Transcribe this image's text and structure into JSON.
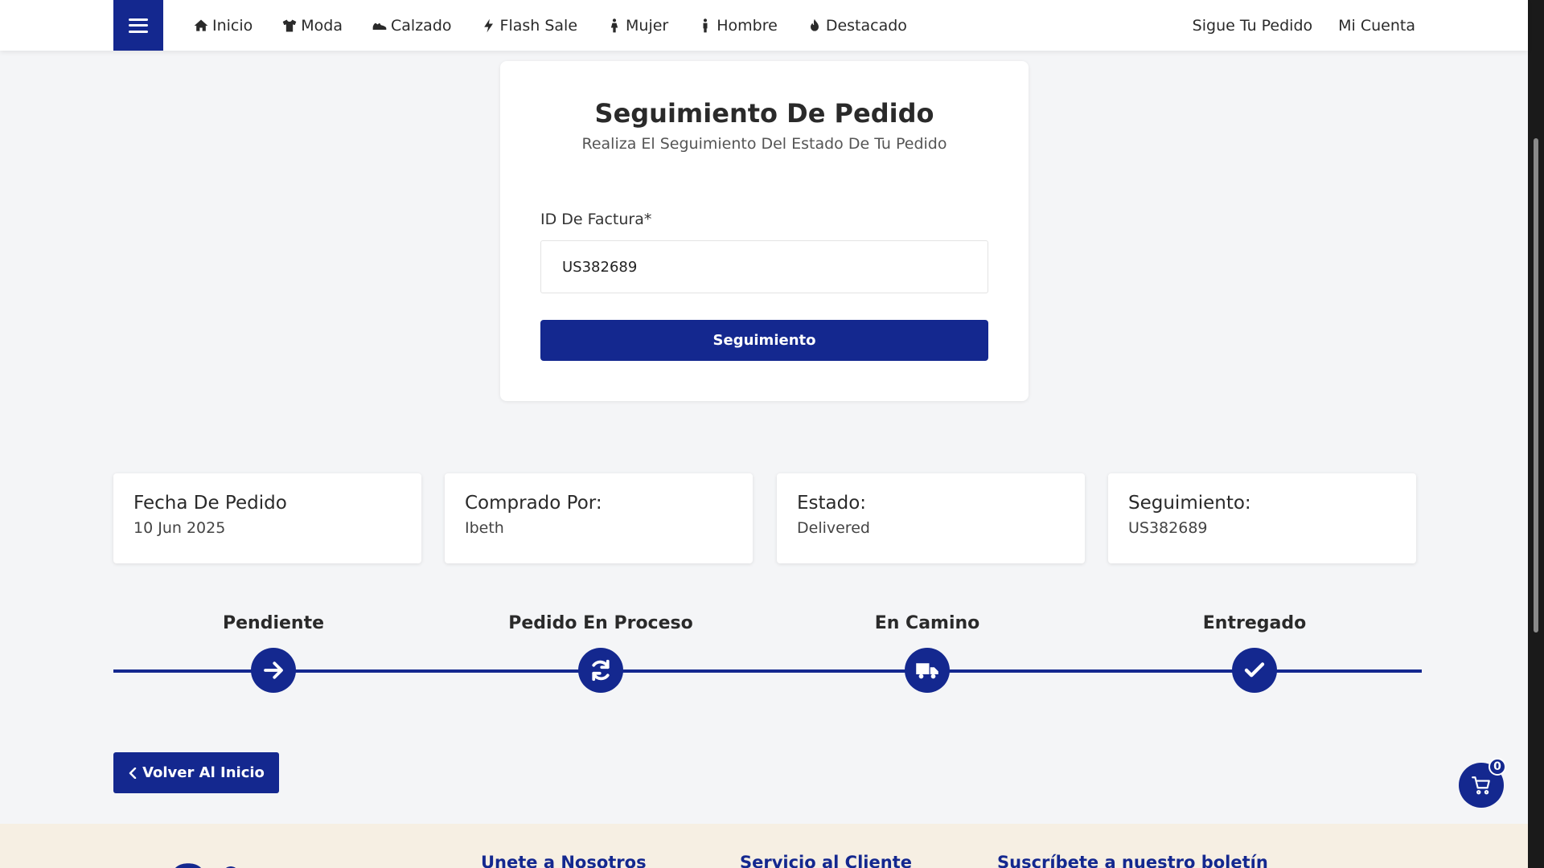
{
  "nav": {
    "items": [
      {
        "label": "Inicio",
        "icon": "home-icon"
      },
      {
        "label": "Moda",
        "icon": "tshirt-icon"
      },
      {
        "label": "Calzado",
        "icon": "shoe-icon"
      },
      {
        "label": "Flash Sale",
        "icon": "bolt-icon"
      },
      {
        "label": "Mujer",
        "icon": "female-icon"
      },
      {
        "label": "Hombre",
        "icon": "male-icon"
      },
      {
        "label": "Destacado",
        "icon": "fire-icon"
      }
    ],
    "right": [
      "Sigue Tu Pedido",
      "Mi Cuenta"
    ]
  },
  "tracking": {
    "title": "Seguimiento De Pedido",
    "subtitle": "Realiza El Seguimiento Del Estado De Tu Pedido",
    "field_label": "ID De Factura*",
    "field_value": "US382689",
    "button": "Seguimiento"
  },
  "info": [
    {
      "label": "Fecha De Pedido",
      "value": "10 Jun 2025"
    },
    {
      "label": "Comprado Por:",
      "value": "Ibeth"
    },
    {
      "label": "Estado:",
      "value": "Delivered"
    },
    {
      "label": "Seguimiento:",
      "value": "US382689"
    }
  ],
  "steps": [
    {
      "label": "Pendiente",
      "icon": "arrow-right-icon"
    },
    {
      "label": "Pedido En Proceso",
      "icon": "refresh-icon"
    },
    {
      "label": "En Camino",
      "icon": "truck-icon"
    },
    {
      "label": "Entregado",
      "icon": "check-icon"
    }
  ],
  "back_button": "Volver Al Inicio",
  "cart": {
    "count": "0"
  },
  "footer": {
    "headings": [
      "Unete a Nosotros",
      "Servicio al Cliente",
      "Suscríbete a nuestro boletín"
    ]
  },
  "colors": {
    "primary": "#14288f",
    "background": "#f4f5f7",
    "footer_bg": "#f6efe3"
  }
}
